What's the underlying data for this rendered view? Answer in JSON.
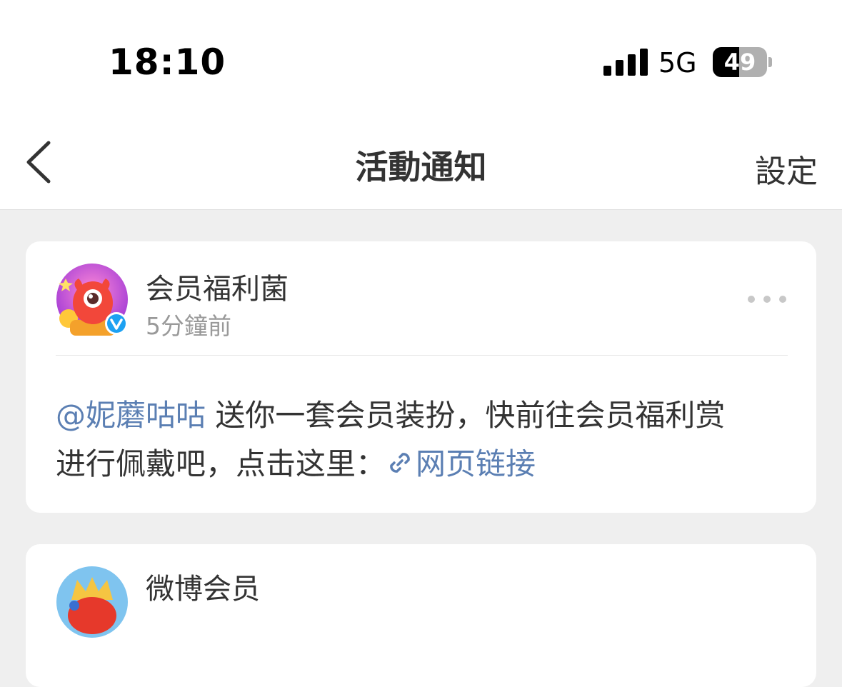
{
  "status_bar": {
    "time": "18:10",
    "network": "5G",
    "battery": "49"
  },
  "nav": {
    "title": "活動通知",
    "settings_label": "設定"
  },
  "notifications": [
    {
      "sender": "会员福利菌",
      "time": "5分鐘前",
      "verified": true,
      "mention": "@妮蘑咕咕",
      "text_line1": " 送你一套会员装扮，快前往会员福利赏",
      "text_line2": "进行佩戴吧，点击这里：",
      "link_label": "网页链接"
    },
    {
      "sender": "微博会员"
    }
  ],
  "colors": {
    "accent_link": "#5b7fb3",
    "verified_badge": "#1da1f2",
    "background": "#efefef"
  },
  "icons": {
    "back": "chevron-left-icon",
    "more": "more-dots-icon",
    "link": "link-icon",
    "verified": "verified-badge-icon"
  }
}
